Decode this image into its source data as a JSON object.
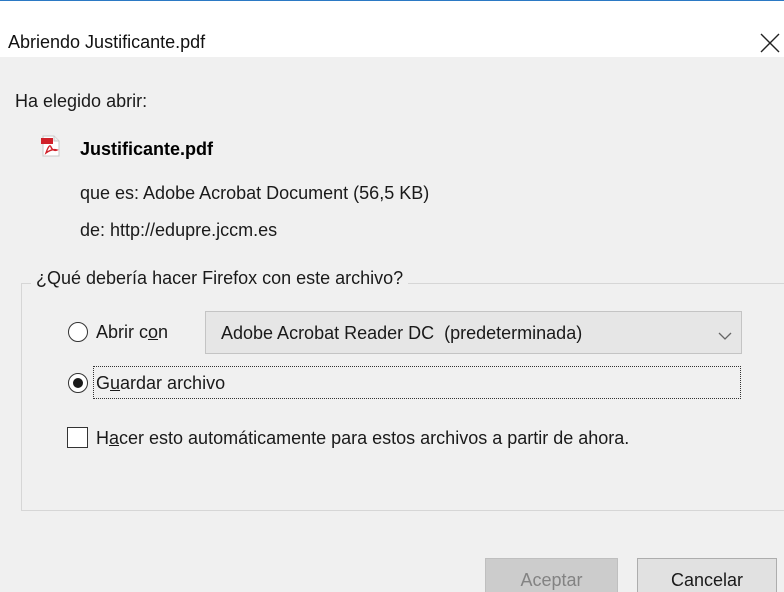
{
  "window": {
    "title": "Abriendo Justificante.pdf",
    "accent_color": "#2b79c4"
  },
  "info": {
    "chosen_label": "Ha elegido abrir:",
    "file_icon": "pdf-file-icon",
    "file_name": "Justificante.pdf",
    "type_line": "que es: Adobe Acrobat Document (56,5 KB)",
    "from_line": "de: http://edupre.jccm.es"
  },
  "group": {
    "legend": "¿Qué debería hacer Firefox con este archivo?"
  },
  "options": {
    "open_with": {
      "pre": "Abrir c",
      "key": "o",
      "post": "n",
      "selected": false
    },
    "app_select": {
      "value": "Adobe Acrobat Reader DC  (predeterminada)"
    },
    "save_file": {
      "pre": "G",
      "key": "u",
      "post": "ardar archivo",
      "selected": true
    },
    "auto": {
      "pre": "H",
      "key": "a",
      "post": "cer esto automáticamente para estos archivos a partir de ahora.",
      "checked": false
    }
  },
  "buttons": {
    "ok_label": "Aceptar",
    "ok_disabled": true,
    "cancel_label": "Cancelar"
  }
}
